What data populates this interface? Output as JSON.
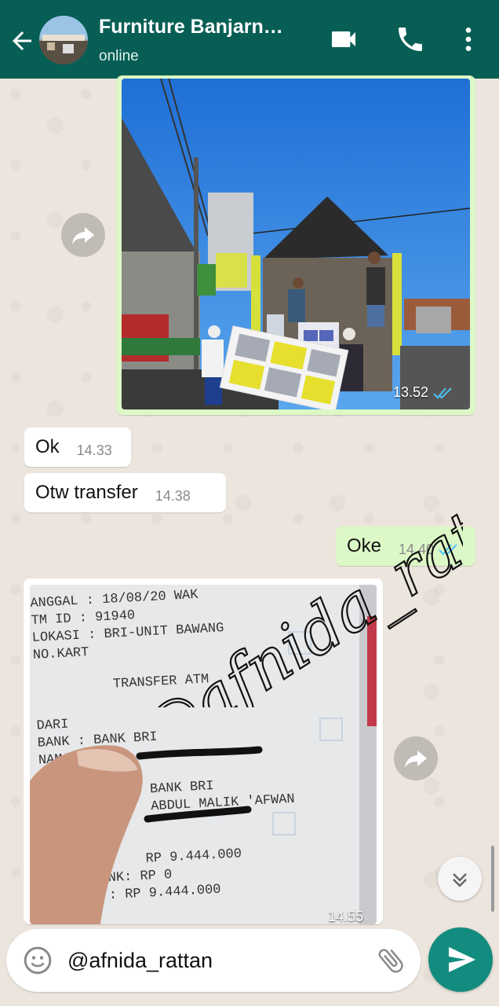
{
  "header": {
    "title": "Furniture Banjarn…",
    "status": "online"
  },
  "messages": {
    "image1": {
      "time": "13.52",
      "ticks": "double-blue"
    },
    "m1": {
      "text": "Ok",
      "time": "14.33"
    },
    "m2": {
      "text": "Otw transfer",
      "time": "14.38"
    },
    "m3": {
      "text": "Oke",
      "time": "14.40"
    },
    "image2": {
      "time": "14.55",
      "receipt_lines": [
        "ANGGAL  : 18/08/20  WAK",
        "TM ID   : 91940",
        "LOKASI  :  BRI-UNIT BAWANG",
        "NO.KART",
        "TRANSFER ATM",
        "DARI",
        "BANK     : BANK BRI",
        "NAMA",
        "KEP",
        "BANK BRI",
        "ABDUL MALIK 'AFWAN",
        "RP       9.444.000",
        "N BANK: RP          0",
        "TAL    : RP   9.444.000"
      ]
    }
  },
  "watermark": {
    "text": "@afnida_rattan"
  },
  "composer": {
    "value": "@afnida_rattan"
  },
  "colors": {
    "header": "#075e54",
    "outgoing": "#dcf8c6",
    "send": "#128c7e",
    "read_ticks": "#4fc3f7"
  },
  "icons": {
    "back": "arrow-left-icon",
    "video": "video-camera-icon",
    "call": "phone-icon",
    "menu": "more-vert-icon",
    "forward": "forward-icon",
    "scroll": "double-chevron-down-icon",
    "emoji": "emoji-icon",
    "attach": "paperclip-icon",
    "send": "send-icon"
  }
}
